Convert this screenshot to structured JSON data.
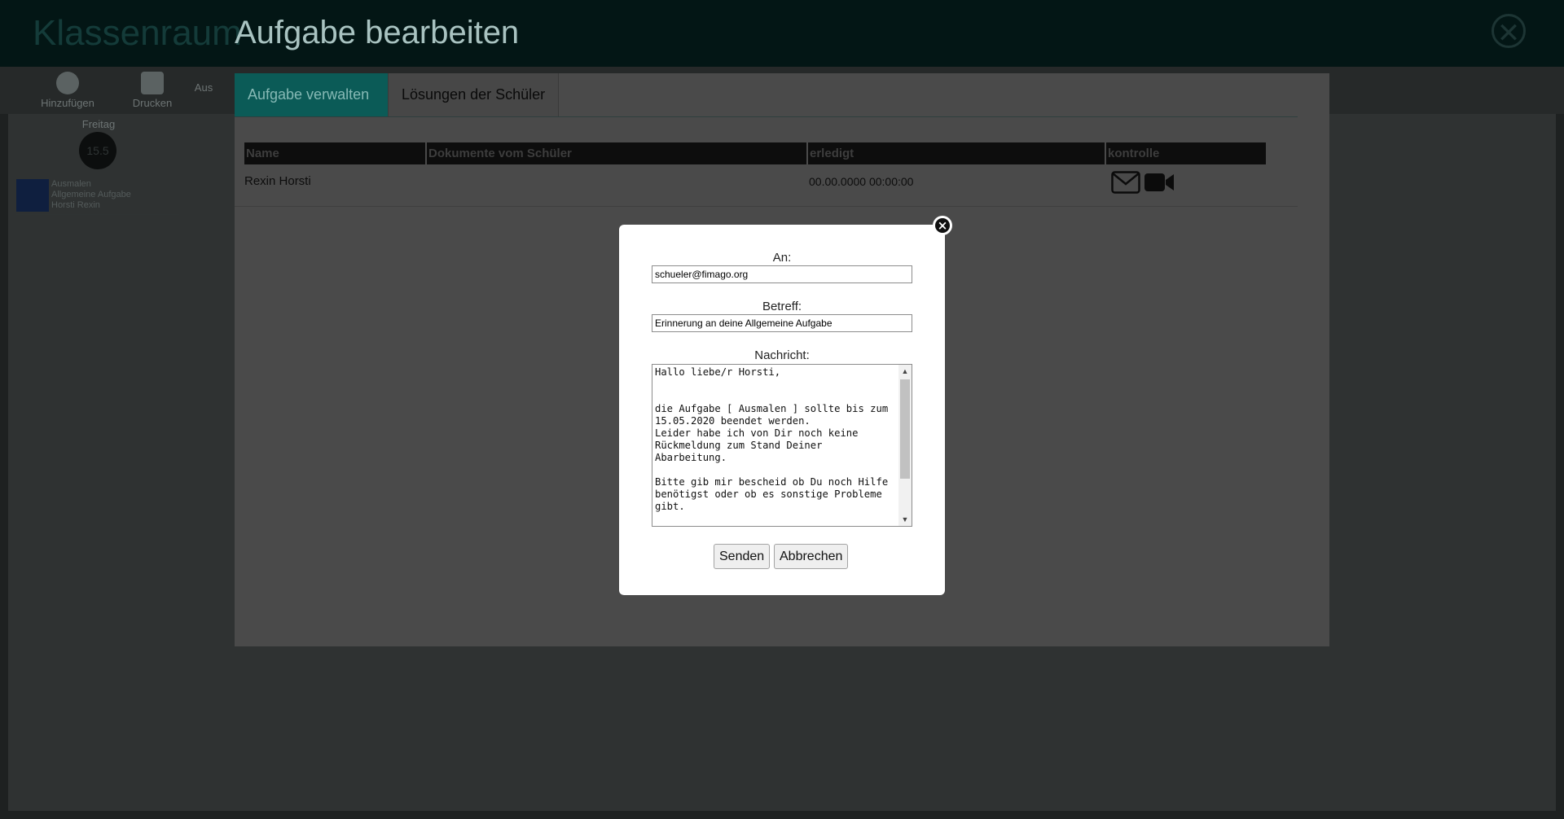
{
  "background": {
    "app_title": "Klassenraum",
    "toolbar": [
      {
        "label": "Hinzufügen"
      },
      {
        "label": "Drucken"
      },
      {
        "label": "Aus"
      }
    ],
    "sidebar_label": "Freitag",
    "badge": "15.5",
    "thumb_lines": [
      "Ausmalen",
      "Allgemeine Aufgabe",
      "Horsti Rexin"
    ]
  },
  "modal": {
    "heading": "Aufgabe bearbeiten",
    "tabs": [
      {
        "label": "Aufgabe verwalten",
        "active": false
      },
      {
        "label": "Lösungen der Schüler",
        "active": true
      }
    ],
    "table": {
      "columns": [
        "Name",
        "Dokumente vom Schüler",
        "erledigt",
        "kontrolle"
      ],
      "rows": [
        {
          "name": "Rexin Horsti",
          "documents": "",
          "erledigt": "00.00.0000 00:00:00",
          "actions": [
            "envelope-icon",
            "video-camera-icon"
          ]
        }
      ]
    }
  },
  "email_dialog": {
    "to_label": "An:",
    "to_value": "schueler@fimago.org",
    "subject_label": "Betreff:",
    "subject_value": "Erinnerung an deine Allgemeine Aufgabe",
    "message_label": "Nachricht:",
    "message_value": "Hallo liebe/r Horsti,\n\n\ndie Aufgabe [ Ausmalen ] sollte bis zum 15.05.2020 beendet werden.\nLeider habe ich von Dir noch keine Rückmeldung zum Stand Deiner Abarbeitung.\n\nBitte gib mir bescheid ob Du noch Hilfe benötigst oder ob es sonstige Probleme gibt.",
    "send_label": "Senden",
    "cancel_label": "Abbrechen"
  },
  "colors": {
    "active_tab": "#0b5b57",
    "overlay_header": "#031615",
    "dialog_bg": "#ffffff"
  }
}
